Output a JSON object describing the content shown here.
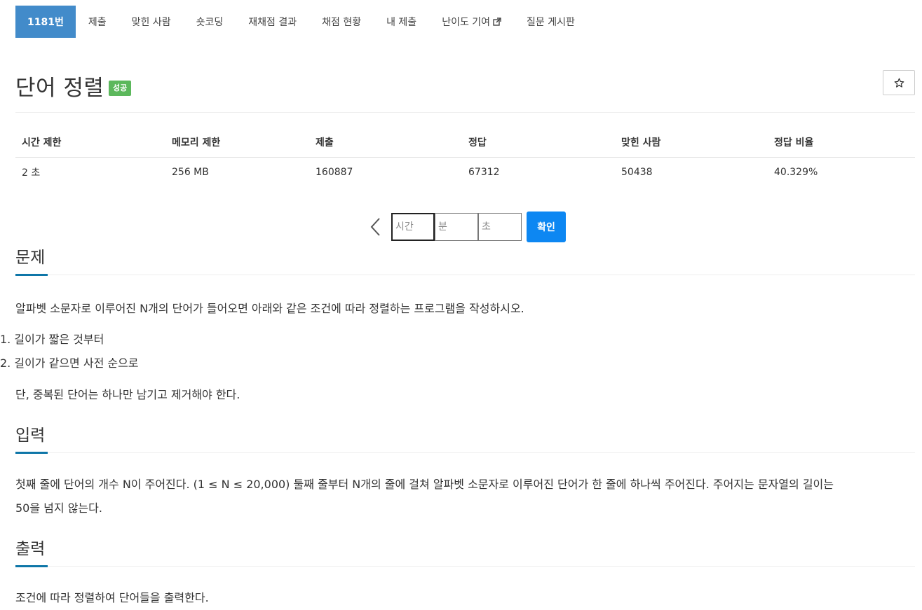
{
  "tabs": [
    {
      "label": "1181번",
      "active": true
    },
    {
      "label": "제출"
    },
    {
      "label": "맞힌 사람"
    },
    {
      "label": "숏코딩"
    },
    {
      "label": "재채점 결과"
    },
    {
      "label": "채점 현황"
    },
    {
      "label": "내 제출"
    },
    {
      "label": "난이도 기여"
    },
    {
      "label": "질문 게시판"
    }
  ],
  "problem": {
    "title": "단어 정렬",
    "status": "성공"
  },
  "info_table": {
    "headers": [
      "시간 제한",
      "메모리 제한",
      "제출",
      "정답",
      "맞힌 사람",
      "정답 비율"
    ],
    "values": [
      "2 초",
      "256 MB",
      "160887",
      "67312",
      "50438",
      "40.329%"
    ]
  },
  "timer": {
    "hour_placeholder": "시간",
    "minute_placeholder": "분",
    "second_placeholder": "초",
    "confirm_label": "확인"
  },
  "sections": {
    "description": {
      "heading": "문제",
      "intro": "알파벳 소문자로 이루어진 N개의 단어가 들어오면 아래와 같은 조건에 따라 정렬하는 프로그램을 작성하시오.",
      "rules": [
        "1. 길이가 짧은 것부터",
        "2. 길이가 같으면 사전 순으로"
      ],
      "note": "단, 중복된 단어는 하나만 남기고 제거해야 한다."
    },
    "input": {
      "heading": "입력",
      "line1": "첫째 줄에 단어의 개수 N이 주어진다. (1 ≤ N ≤ 20,000) 둘째 줄부터 N개의 줄에 걸쳐 알파벳 소문자로 이루어진 단어가 한 줄에 하나씩 주어진다. 주어지는 문자열의 길이는",
      "line2": "50을 넘지 않는다."
    },
    "output": {
      "heading": "출력",
      "text": "조건에 따라 정렬하여 단어들을 출력한다."
    }
  },
  "colors": {
    "active_tab": "#428bca",
    "badge": "#5cb85c",
    "confirm_button": "#0d87f2",
    "section_underline": "#0e76a8"
  }
}
